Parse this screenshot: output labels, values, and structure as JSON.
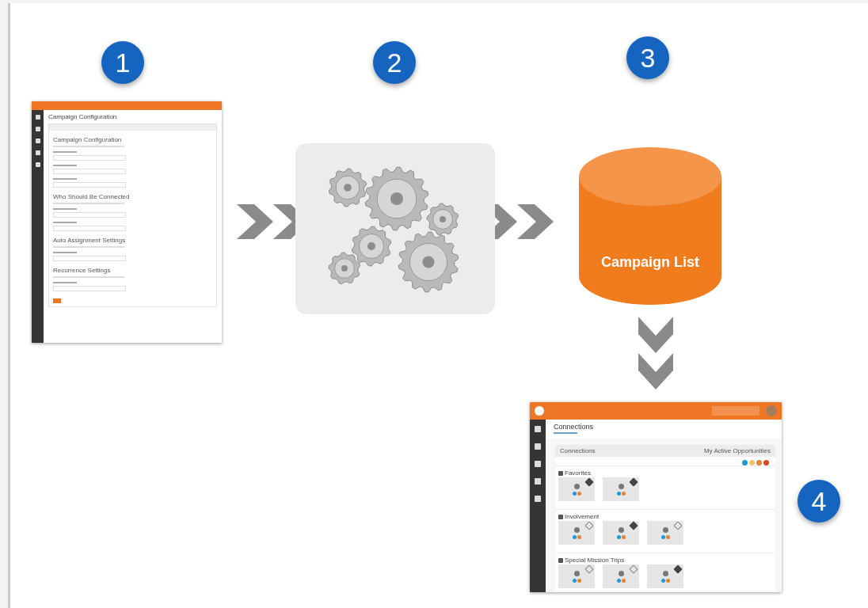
{
  "steps": [
    {
      "label": "1"
    },
    {
      "label": "2"
    },
    {
      "label": "3"
    },
    {
      "label": "4"
    }
  ],
  "config_screen": {
    "title": "Campaign Configuration",
    "sections": [
      "Campaign Configuration",
      "Who Should Be Connected",
      "Auto Assignment Settings",
      "Recurrence Settings"
    ]
  },
  "database": {
    "label": "Campaign List"
  },
  "connections_screen": {
    "title": "Connections",
    "panel_title": "Connections",
    "filter": "My Active Opportunities",
    "status_dots": [
      {
        "color": "#1a9ad6"
      },
      {
        "color": "#f2c46a"
      },
      {
        "color": "#e8822e"
      },
      {
        "color": "#d9452a"
      }
    ],
    "groups": [
      {
        "name": "Favorites",
        "cards": [
          {
            "starred": true
          },
          {
            "starred": true
          }
        ]
      },
      {
        "name": "Involvement",
        "cards": [
          {
            "starred": false
          },
          {
            "starred": true
          },
          {
            "starred": false
          }
        ]
      },
      {
        "name": "Special Mission Trips",
        "cards": [
          {
            "starred": false
          },
          {
            "starred": false
          },
          {
            "starred": true
          }
        ]
      }
    ]
  }
}
